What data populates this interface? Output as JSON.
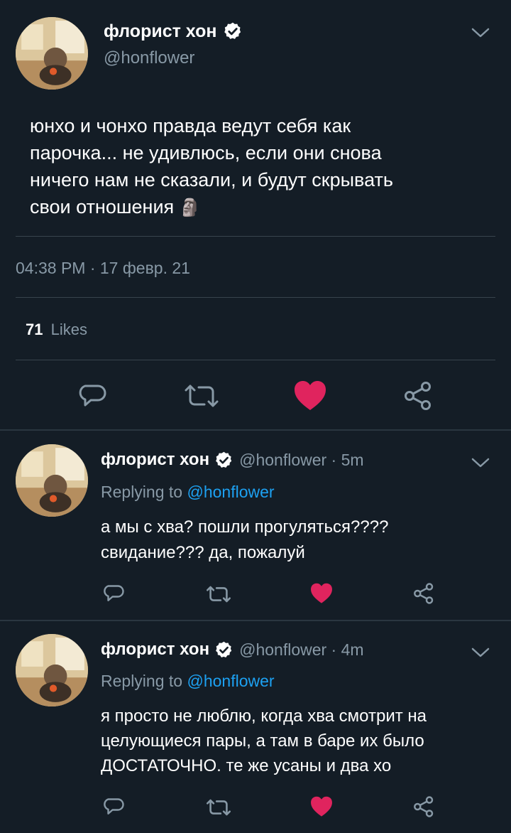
{
  "main_tweet": {
    "display_name": "флорист хон",
    "handle": "@honflower",
    "text_lines": [
      "юнхо и чонхо правда ведут себя как",
      "парочка... не удивлюсь, если они снова",
      "ничего нам не сказали, и будут скрывать",
      "свои отношения"
    ],
    "emoji": "🗿",
    "timestamp": "04:38 PM · 17 февр. 21",
    "likes_count": "71",
    "likes_label": "Likes"
  },
  "replies": [
    {
      "display_name": "флорист хон",
      "meta": "@honflower · 5m",
      "replying_label": "Replying to",
      "replying_to": "@honflower",
      "text_lines": [
        "а мы с хва? пошли прогуляться????",
        "свидание??? да, пожалуй"
      ]
    },
    {
      "display_name": "флорист хон",
      "meta": "@honflower · 4m",
      "replying_label": "Replying to",
      "replying_to": "@honflower",
      "text_lines": [
        "я просто не люблю, когда хва смотрит на",
        "целующиеся пары, а там в баре их было",
        "ДОСТАТОЧНО. те же усаны и два хо"
      ]
    }
  ],
  "colors": {
    "background": "#141d26",
    "muted": "#8899a6",
    "link": "#1da1f2",
    "like": "#e0245e",
    "divider": "#38444d"
  },
  "icons": [
    "chevron-down-icon",
    "verified-badge-icon",
    "reply-icon",
    "retweet-icon",
    "like-heart-icon",
    "share-icon"
  ]
}
